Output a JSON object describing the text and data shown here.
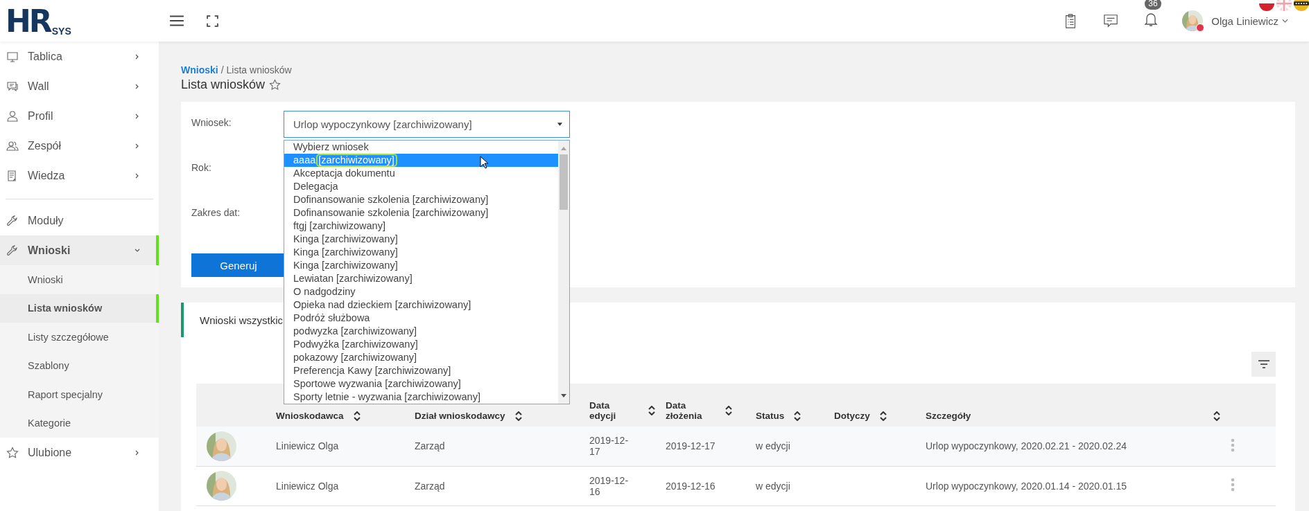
{
  "header": {
    "logo": {
      "mark": "HR",
      "text": "SYS"
    },
    "notifications": "36",
    "user": {
      "name": "Olga Liniewicz"
    }
  },
  "sidebar": {
    "sections": [
      [
        {
          "label": "Tablica",
          "kind": "group",
          "expanded": false,
          "selected": false
        },
        {
          "label": "Wall",
          "kind": "group",
          "expanded": false,
          "selected": false
        },
        {
          "label": "Profil",
          "kind": "group",
          "expanded": false,
          "selected": false
        },
        {
          "label": "Zespół",
          "kind": "group",
          "expanded": false,
          "selected": false
        },
        {
          "label": "Wiedza",
          "kind": "group",
          "expanded": false,
          "selected": false
        }
      ],
      [
        {
          "label": "Moduły",
          "kind": "link",
          "selected": false
        },
        {
          "label": "Wnioski",
          "kind": "group",
          "expanded": true,
          "selected": true,
          "children": [
            {
              "label": "Wnioski",
              "selected": false
            },
            {
              "label": "Lista wniosków",
              "selected": true
            },
            {
              "label": "Listy szczegółowe",
              "selected": false
            },
            {
              "label": "Szablony",
              "selected": false
            },
            {
              "label": "Raport specjalny",
              "selected": false
            },
            {
              "label": "Kategorie",
              "selected": false
            }
          ]
        },
        {
          "label": "Ulubione",
          "kind": "group",
          "expanded": false,
          "selected": false
        }
      ]
    ]
  },
  "breadcrumb": {
    "link": "Wnioski",
    "separator": "/",
    "current": "Lista wniosków"
  },
  "page_title": {
    "text": "Lista wniosków",
    "favorite": false
  },
  "form": {
    "fields": [
      {
        "label": "Wniosek:"
      },
      {
        "label": "Rok:"
      },
      {
        "label": "Zakres dat:"
      }
    ],
    "select": {
      "value": "Urlop wypoczynkowy [zarchiwizowany]",
      "open": true,
      "options": [
        {
          "label": "Wybierz wniosek",
          "selected": false
        },
        {
          "label": "aaaa [zarchiwizowany]",
          "selected": true,
          "annotated": true
        },
        {
          "label": "Akceptacja dokumentu",
          "selected": false
        },
        {
          "label": "Delegacja",
          "selected": false
        },
        {
          "label": "Dofinansowanie szkolenia [zarchiwizowany]",
          "selected": false
        },
        {
          "label": "Dofinansowanie szkolenia [zarchiwizowany]",
          "selected": false
        },
        {
          "label": "ftgj [zarchiwizowany]",
          "selected": false
        },
        {
          "label": "Kinga [zarchiwizowany]",
          "selected": false
        },
        {
          "label": "Kinga [zarchiwizowany]",
          "selected": false
        },
        {
          "label": "Kinga [zarchiwizowany]",
          "selected": false
        },
        {
          "label": "Lewiatan [zarchiwizowany]",
          "selected": false
        },
        {
          "label": "O nadgodziny",
          "selected": false
        },
        {
          "label": "Opieka nad dzieckiem [zarchiwizowany]",
          "selected": false
        },
        {
          "label": "Podróż służbowa",
          "selected": false
        },
        {
          "label": "podwyzka [zarchiwizowany]",
          "selected": false
        },
        {
          "label": "Podwyżka [zarchiwizowany]",
          "selected": false
        },
        {
          "label": "pokazowy [zarchiwizowany]",
          "selected": false
        },
        {
          "label": "Preferencja Kawy [zarchiwizowany]",
          "selected": false
        },
        {
          "label": "Sportowe wyzwania [zarchiwizowany]",
          "selected": false
        },
        {
          "label": "Sporty letnie - wyzwania [zarchiwizowany]",
          "selected": false
        }
      ]
    },
    "button": "Generuj"
  },
  "panel": {
    "title": "Wnioski wszystkic",
    "table": {
      "columns": [
        {
          "label": "Wnioskodawca",
          "sortable": true
        },
        {
          "label": "Dział wnioskodawcy",
          "sortable": true
        },
        {
          "label": "Data edycji",
          "sortable": true
        },
        {
          "label": "Data złożenia",
          "sortable": true
        },
        {
          "label": "Status",
          "sortable": true
        },
        {
          "label": "Dotyczy",
          "sortable": true
        },
        {
          "label": "Szczegóły",
          "sortable": true
        }
      ],
      "rows": [
        {
          "applicant": "Liniewicz Olga",
          "department": "Zarząd",
          "edited": "2019-12-17",
          "submitted": "2019-12-17",
          "status": "w edycji",
          "details": "Urlop wypoczynkowy, 2020.02.21 - 2020.02.24"
        },
        {
          "applicant": "Liniewicz Olga",
          "department": "Zarząd",
          "edited": "2019-12-16",
          "submitted": "2019-12-16",
          "status": "w edycji",
          "details": "Urlop wypoczynkowy, 2020.01.14 - 2020.01.15"
        }
      ]
    }
  }
}
